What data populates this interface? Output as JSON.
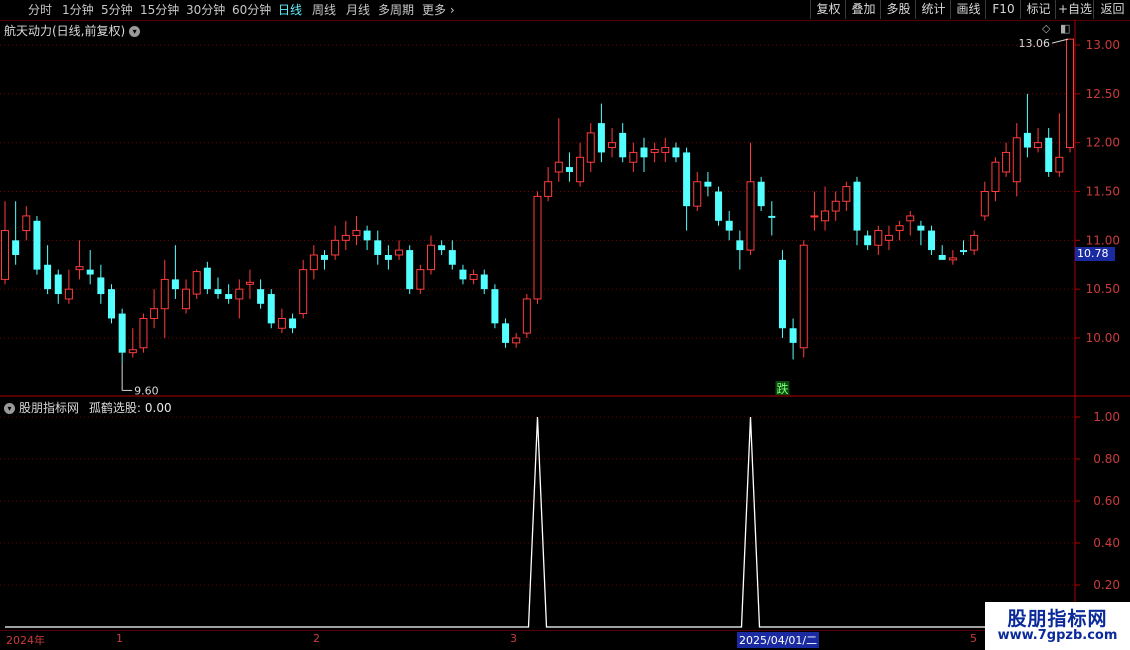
{
  "toolbar": {
    "periods": [
      "分时",
      "1分钟",
      "5分钟",
      "15分钟",
      "30分钟",
      "60分钟",
      "日线",
      "周线",
      "月线",
      "多周期",
      "更多"
    ],
    "active_period": "日线",
    "right_buttons": [
      "复权",
      "叠加",
      "多股",
      "统计",
      "画线",
      "F10",
      "标记",
      "+自选",
      "返回"
    ]
  },
  "main_chart": {
    "title": "航天动力(日线,前复权)",
    "high_label": "13.06",
    "low_label": "9.60",
    "current_price": "10.78",
    "signal_marker": "跌",
    "y_ticks": [
      "13.00",
      "12.50",
      "12.00",
      "11.50",
      "11.00",
      "10.50",
      "10.00"
    ]
  },
  "indicator": {
    "title": "股朋指标网",
    "name": "孤鹤选股",
    "value_label": "0.00",
    "y_ticks": [
      "1.00",
      "0.80",
      "0.60",
      "0.40",
      "0.20"
    ]
  },
  "date_axis": {
    "labels": [
      "2024年",
      "1",
      "2",
      "3",
      "2025/04/01/二",
      "5"
    ]
  },
  "watermark": {
    "line1": "股朋指标网",
    "line2": "www.7gpzb.com"
  },
  "colors": {
    "up": "#ff3c3c",
    "down": "#54ffff",
    "grid": "#7a0000",
    "axis": "#b00000",
    "active": "#5ff3ff",
    "price_tag_bg": "#1a2aa0"
  },
  "chart_data": [
    {
      "type": "candlestick",
      "title": "航天动力(日线,前复权)",
      "ylim": [
        9.4,
        13.2
      ],
      "candles": [
        [
          10.6,
          11.1,
          11.4,
          10.55
        ],
        [
          11.0,
          10.85,
          11.4,
          10.75
        ],
        [
          11.1,
          11.25,
          11.35,
          11.0
        ],
        [
          11.2,
          10.7,
          11.25,
          10.65
        ],
        [
          10.75,
          10.5,
          10.95,
          10.45
        ],
        [
          10.65,
          10.45,
          10.7,
          10.35
        ],
        [
          10.4,
          10.5,
          10.7,
          10.35
        ],
        [
          10.7,
          10.73,
          11.0,
          10.6
        ],
        [
          10.7,
          10.65,
          10.9,
          10.55
        ],
        [
          10.62,
          10.45,
          10.75,
          10.35
        ],
        [
          10.5,
          10.2,
          10.55,
          10.15
        ],
        [
          10.25,
          9.85,
          10.3,
          9.75
        ],
        [
          9.85,
          9.88,
          10.1,
          9.8
        ],
        [
          9.9,
          10.2,
          10.25,
          9.85
        ],
        [
          10.2,
          10.3,
          10.5,
          10.1
        ],
        [
          10.3,
          10.6,
          10.8,
          10.0
        ],
        [
          10.6,
          10.5,
          10.95,
          10.4
        ],
        [
          10.3,
          10.5,
          10.6,
          10.25
        ],
        [
          10.45,
          10.68,
          10.7,
          10.4
        ],
        [
          10.72,
          10.5,
          10.78,
          10.45
        ],
        [
          10.5,
          10.45,
          10.62,
          10.4
        ],
        [
          10.45,
          10.4,
          10.55,
          10.35
        ],
        [
          10.4,
          10.5,
          10.6,
          10.2
        ],
        [
          10.55,
          10.57,
          10.7,
          10.4
        ],
        [
          10.5,
          10.35,
          10.6,
          10.3
        ],
        [
          10.45,
          10.15,
          10.5,
          10.1
        ],
        [
          10.1,
          10.2,
          10.3,
          10.05
        ],
        [
          10.2,
          10.1,
          10.25,
          10.05
        ],
        [
          10.25,
          10.7,
          10.8,
          10.2
        ],
        [
          10.7,
          10.85,
          10.95,
          10.6
        ],
        [
          10.85,
          10.8,
          10.9,
          10.7
        ],
        [
          10.85,
          11.0,
          11.15,
          10.8
        ],
        [
          11.0,
          11.05,
          11.2,
          10.9
        ],
        [
          11.05,
          11.1,
          11.25,
          10.95
        ],
        [
          11.1,
          11.0,
          11.15,
          10.9
        ],
        [
          11.0,
          10.85,
          11.1,
          10.75
        ],
        [
          10.85,
          10.8,
          10.95,
          10.7
        ],
        [
          10.85,
          10.9,
          11.0,
          10.8
        ],
        [
          10.9,
          10.5,
          10.95,
          10.45
        ],
        [
          10.5,
          10.7,
          10.75,
          10.45
        ],
        [
          10.7,
          10.95,
          11.05,
          10.65
        ],
        [
          10.95,
          10.9,
          11.0,
          10.85
        ],
        [
          10.9,
          10.75,
          11.0,
          10.7
        ],
        [
          10.7,
          10.6,
          10.75,
          10.55
        ],
        [
          10.6,
          10.65,
          10.7,
          10.55
        ],
        [
          10.65,
          10.5,
          10.7,
          10.45
        ],
        [
          10.5,
          10.15,
          10.55,
          10.1
        ],
        [
          10.15,
          9.95,
          10.2,
          9.9
        ],
        [
          9.95,
          10.0,
          10.05,
          9.9
        ],
        [
          10.05,
          10.4,
          10.45,
          10.0
        ],
        [
          10.4,
          11.45,
          11.5,
          10.35
        ],
        [
          11.45,
          11.6,
          11.75,
          11.4
        ],
        [
          11.7,
          11.8,
          12.25,
          11.6
        ],
        [
          11.75,
          11.7,
          11.9,
          11.6
        ],
        [
          11.6,
          11.85,
          12.0,
          11.55
        ],
        [
          11.8,
          12.1,
          12.2,
          11.7
        ],
        [
          12.2,
          11.9,
          12.4,
          11.8
        ],
        [
          11.95,
          12.0,
          12.15,
          11.85
        ],
        [
          12.1,
          11.85,
          12.2,
          11.8
        ],
        [
          11.8,
          11.9,
          12.0,
          11.7
        ],
        [
          11.95,
          11.85,
          12.05,
          11.7
        ],
        [
          11.9,
          11.93,
          12.0,
          11.8
        ],
        [
          11.9,
          11.95,
          12.05,
          11.8
        ],
        [
          11.95,
          11.85,
          12.0,
          11.8
        ],
        [
          11.9,
          11.35,
          11.95,
          11.1
        ],
        [
          11.35,
          11.6,
          11.7,
          11.3
        ],
        [
          11.6,
          11.55,
          11.7,
          11.45
        ],
        [
          11.5,
          11.2,
          11.55,
          11.15
        ],
        [
          11.2,
          11.1,
          11.3,
          11.0
        ],
        [
          11.0,
          10.9,
          11.1,
          10.7
        ],
        [
          10.9,
          11.6,
          12.0,
          10.85
        ],
        [
          11.6,
          11.35,
          11.65,
          11.3
        ],
        [
          11.25,
          11.23,
          11.4,
          11.05
        ],
        [
          10.8,
          10.1,
          10.9,
          10.0
        ],
        [
          10.1,
          9.95,
          10.2,
          9.78
        ],
        [
          9.9,
          10.95,
          11.0,
          9.8
        ],
        [
          11.25,
          11.25,
          11.5,
          11.1
        ],
        [
          11.2,
          11.3,
          11.55,
          11.1
        ],
        [
          11.3,
          11.4,
          11.5,
          11.2
        ],
        [
          11.4,
          11.55,
          11.6,
          11.3
        ],
        [
          11.6,
          11.1,
          11.65,
          10.95
        ],
        [
          11.05,
          10.95,
          11.1,
          10.9
        ],
        [
          10.95,
          11.1,
          11.15,
          10.85
        ],
        [
          11.0,
          11.05,
          11.15,
          10.9
        ],
        [
          11.1,
          11.15,
          11.2,
          11.0
        ],
        [
          11.2,
          11.25,
          11.3,
          11.05
        ],
        [
          11.15,
          11.1,
          11.2,
          10.95
        ],
        [
          11.1,
          10.9,
          11.15,
          10.85
        ],
        [
          10.85,
          10.8,
          10.95,
          10.8
        ],
        [
          10.8,
          10.82,
          10.9,
          10.75
        ],
        [
          10.9,
          10.88,
          11.0,
          10.85
        ],
        [
          10.9,
          11.05,
          11.1,
          10.85
        ],
        [
          11.25,
          11.5,
          11.6,
          11.2
        ],
        [
          11.5,
          11.8,
          11.85,
          11.4
        ],
        [
          11.7,
          11.9,
          12.0,
          11.65
        ],
        [
          11.6,
          12.05,
          12.2,
          11.45
        ],
        [
          12.1,
          11.95,
          12.5,
          11.85
        ],
        [
          11.95,
          12.0,
          12.15,
          11.9
        ],
        [
          12.05,
          11.7,
          12.15,
          11.65
        ],
        [
          11.7,
          11.85,
          12.3,
          11.65
        ],
        [
          11.95,
          13.06,
          13.06,
          11.9
        ]
      ]
    },
    {
      "type": "line",
      "title": "孤鹤选股",
      "ylim": [
        0,
        1.05
      ],
      "x": [
        0,
        1,
        2,
        3,
        4,
        5,
        6,
        7,
        8,
        9,
        10,
        11,
        12,
        13,
        14,
        15,
        16,
        17,
        18,
        19,
        20,
        21,
        22,
        23,
        24,
        25,
        26,
        27,
        28,
        29,
        30,
        31,
        32,
        33,
        34,
        35,
        36,
        37,
        38,
        39,
        40,
        41,
        42,
        43,
        44,
        45,
        46,
        47,
        48,
        49,
        50,
        51,
        52,
        53,
        54,
        55,
        56,
        57,
        58,
        59,
        60,
        61,
        62,
        63,
        64,
        65,
        66,
        67,
        68,
        69,
        70,
        71,
        72,
        73,
        74,
        75,
        76,
        77,
        78,
        79,
        80,
        81,
        82,
        83,
        84,
        85,
        86,
        87,
        88,
        89,
        90,
        91,
        92,
        93,
        94,
        95,
        96,
        97,
        98,
        99,
        100
      ],
      "values": [
        0,
        0,
        0,
        0,
        0,
        0,
        0,
        0,
        0,
        0,
        0,
        0,
        0,
        0,
        0,
        0,
        0,
        0,
        0,
        0,
        0,
        0,
        0,
        0,
        0,
        0,
        0,
        0,
        0,
        0,
        0,
        0,
        0,
        0,
        0,
        0,
        0,
        0,
        0,
        0,
        0,
        0,
        0,
        0,
        0,
        0,
        0,
        0,
        0,
        0,
        1,
        0,
        0,
        0,
        0,
        0,
        0,
        0,
        0,
        0,
        0,
        0,
        0,
        0,
        0,
        0,
        0,
        0,
        0,
        0,
        1,
        0,
        0,
        0,
        0,
        0,
        0,
        0,
        0,
        0,
        0,
        0,
        0,
        0,
        0,
        0,
        0,
        0,
        0,
        0,
        0,
        0,
        0,
        0,
        0,
        0,
        0,
        0,
        0,
        0,
        0
      ]
    }
  ]
}
